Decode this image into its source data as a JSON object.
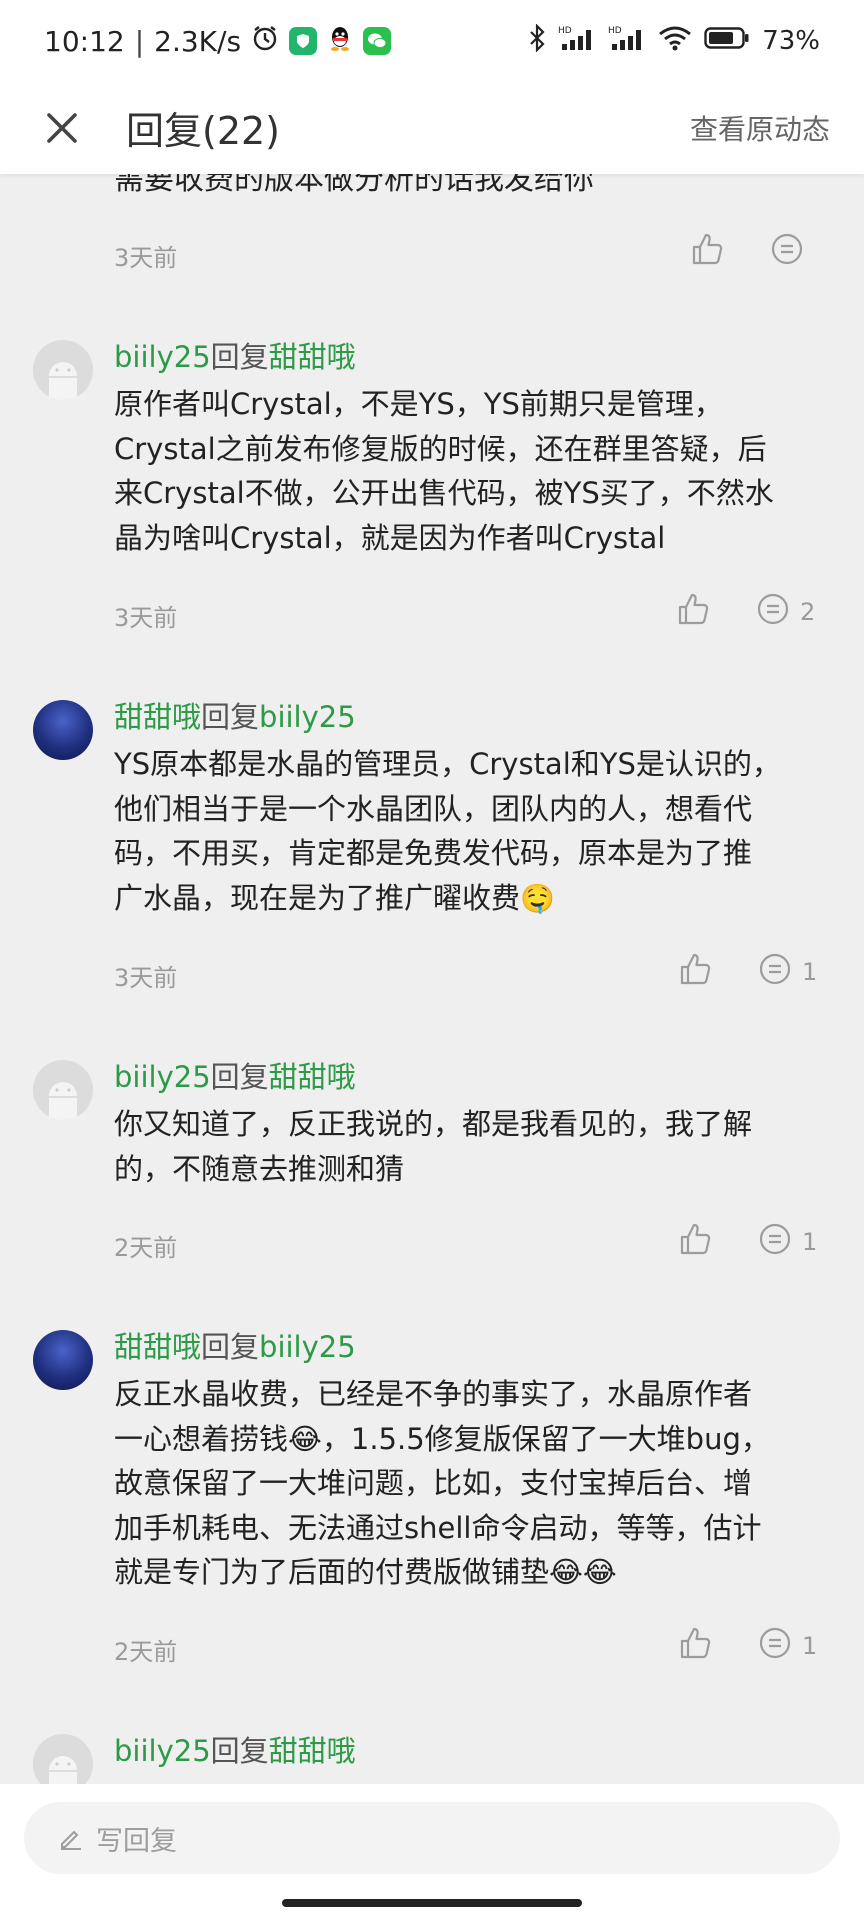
{
  "status_bar": {
    "time": "10:12",
    "speed": "2.3K/s",
    "battery": "73%",
    "icons": [
      "alarm-icon",
      "shield-app-icon",
      "qq-icon",
      "wechat-icon",
      "bluetooth-icon",
      "signal-hd-icon",
      "signal-hd-icon",
      "wifi-icon",
      "battery-icon"
    ]
  },
  "header": {
    "title": "回复(22)",
    "view_original": "查看原动态"
  },
  "partial_comment": {
    "text": "需要收费的版本做分析的话我发给你",
    "time": "3天前"
  },
  "comments": [
    {
      "author": "biily25",
      "reply_word": "回复",
      "target": "甜甜哦",
      "avatar": "default",
      "text": "原作者叫Crystal，不是YS，YS前期只是管理，\nCrystal之前发布修复版的时候，还在群里答疑，后\n来Crystal不做，公开出售代码，被YS买了，不然水\n晶为啥叫Crystal，就是因为作者叫Crystal",
      "time": "3天前",
      "reply_count": "2"
    },
    {
      "author": "甜甜哦",
      "reply_word": "回复",
      "target": "biily25",
      "avatar": "blue",
      "text": "YS原本都是水晶的管理员，Crystal和YS是认识的，\n他们相当于是一个水晶团队，团队内的人，想看代\n码，不用买，肯定都是免费发代码，原本是为了推\n广水晶，现在是为了推广曜收费",
      "text_emoji": "🤤",
      "time": "3天前",
      "reply_count": "1"
    },
    {
      "author": "biily25",
      "reply_word": "回复",
      "target": "甜甜哦",
      "avatar": "default",
      "text": "你又知道了，反正我说的，都是我看见的，我了解\n的，不随意去推测和猜",
      "time": "2天前",
      "reply_count": "1"
    },
    {
      "author": "甜甜哦",
      "reply_word": "回复",
      "target": "biily25",
      "avatar": "blue",
      "text": "反正水晶收费，已经是不争的事实了，水晶原作者\n一心想着捞钱😂，1.5.5修复版保留了一大堆bug，\n故意保留了一大堆问题，比如，支付宝掉后台、增\n加手机耗电、无法通过shell命令启动，等等，估计\n就是专门为了后面的付费版做铺垫😂😂",
      "time": "2天前",
      "reply_count": "1"
    },
    {
      "author": "biily25",
      "reply_word": "回复",
      "target": "甜甜哦",
      "avatar": "default"
    }
  ],
  "reply_bar": {
    "placeholder": "写回复"
  }
}
